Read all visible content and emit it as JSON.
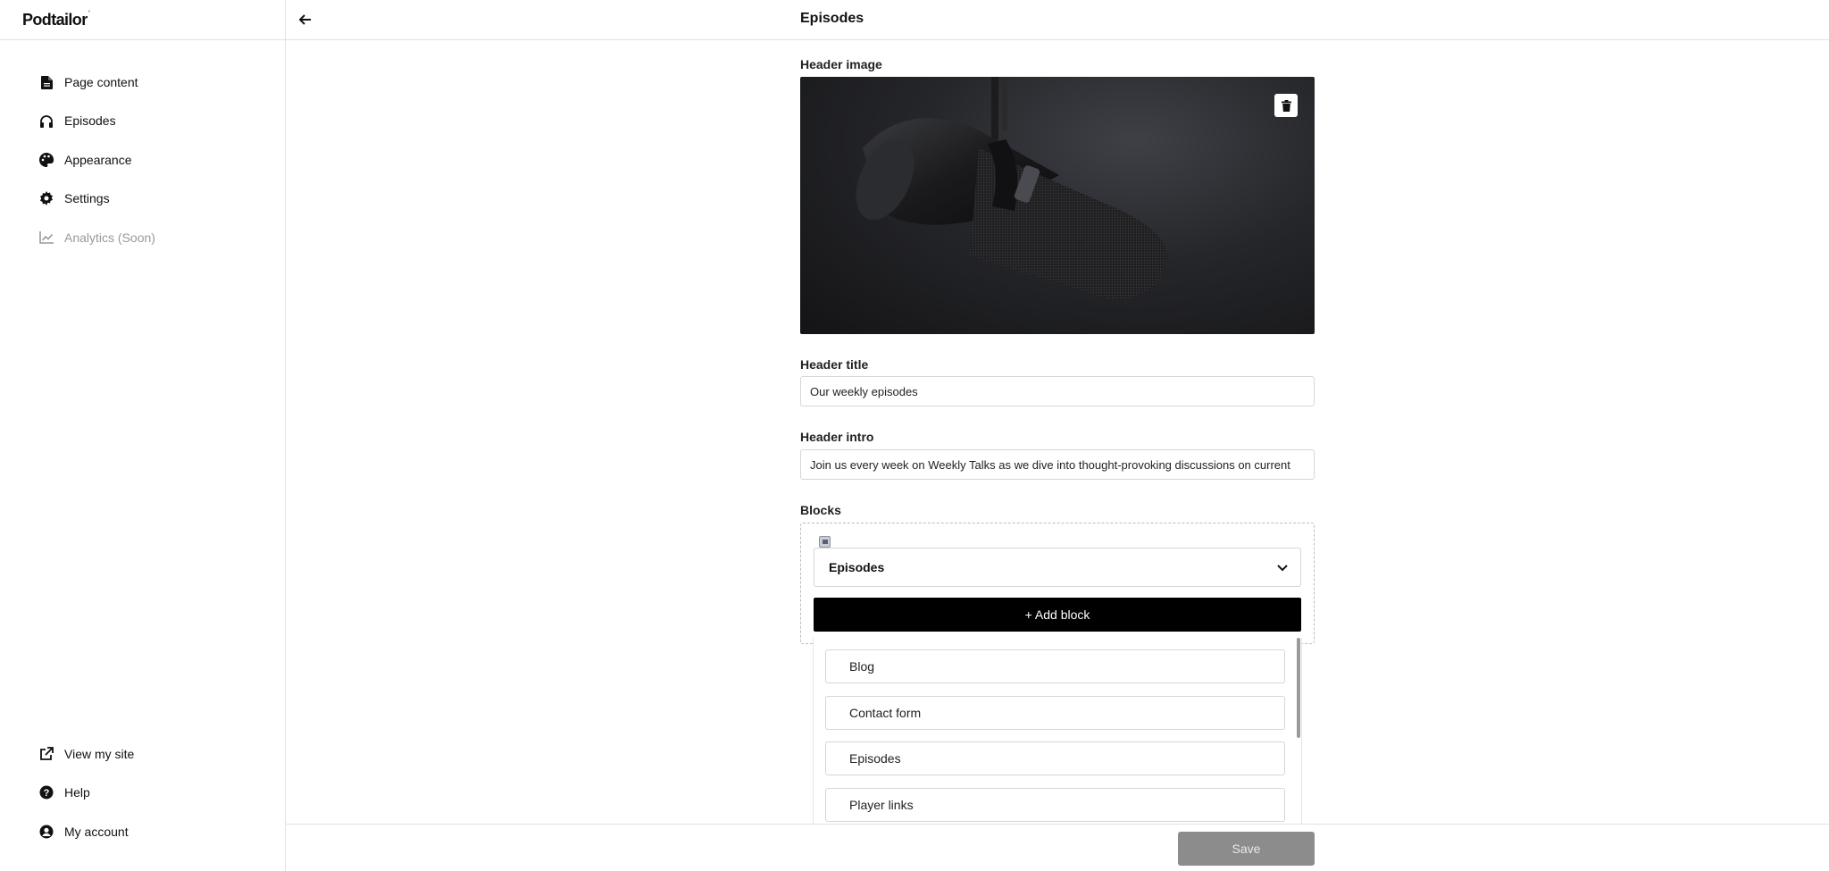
{
  "app": {
    "logo": "Podtailor",
    "logo_mark": "°"
  },
  "sidebar": {
    "items": [
      {
        "label": "Page content",
        "icon": "file-icon"
      },
      {
        "label": "Episodes",
        "icon": "headphones-icon"
      },
      {
        "label": "Appearance",
        "icon": "palette-icon"
      },
      {
        "label": "Settings",
        "icon": "gear-icon"
      },
      {
        "label": "Analytics (Soon)",
        "icon": "chart-icon",
        "disabled": true
      }
    ],
    "bottom_items": [
      {
        "label": "View my site",
        "icon": "external-link-icon"
      },
      {
        "label": "Help",
        "icon": "help-icon"
      },
      {
        "label": "My account",
        "icon": "user-circle-icon"
      }
    ]
  },
  "header": {
    "title": "Episodes"
  },
  "form": {
    "header_image_label": "Header image",
    "header_title_label": "Header title",
    "header_title_value": "Our weekly episodes",
    "header_intro_label": "Header intro",
    "header_intro_value": "Join us every week on Weekly Talks as we dive into thought-provoking discussions on current",
    "blocks_label": "Blocks",
    "block_select_value": "Episodes",
    "add_block_label": "+ Add block",
    "block_options": [
      "Blog",
      "Contact form",
      "Episodes",
      "Player links"
    ]
  },
  "footer": {
    "save_label": "Save"
  },
  "colors": {
    "primary_button": "#000000",
    "save_disabled": "#8c8c8c",
    "border": "#d6d6d6"
  }
}
